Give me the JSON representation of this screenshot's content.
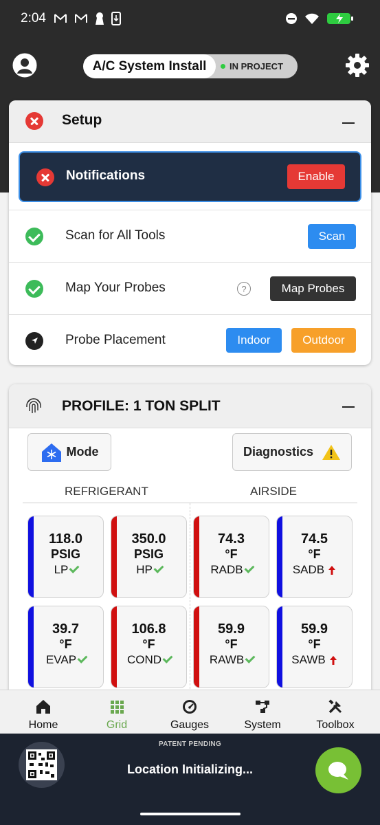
{
  "status_bar": {
    "time": "2:04"
  },
  "header": {
    "title": "A/C System Install",
    "project_status": "IN PROJECT"
  },
  "setup": {
    "title": "Setup",
    "notifications": {
      "label": "Notifications",
      "button": "Enable"
    },
    "scan": {
      "label": "Scan for All Tools",
      "button": "Scan"
    },
    "map": {
      "label": "Map Your Probes",
      "help": "?",
      "button": "Map Probes"
    },
    "placement": {
      "label": "Probe Placement",
      "indoor": "Indoor",
      "outdoor": "Outdoor"
    }
  },
  "profile": {
    "title": "PROFILE: 1 TON SPLIT",
    "mode_button": "Mode",
    "diagnostics_button": "Diagnostics",
    "refrigerant_header": "REFRIGERANT",
    "airside_header": "AIRSIDE",
    "tiles": [
      {
        "value": "118.0",
        "unit": "PSIG",
        "name": "LP",
        "status": "ok",
        "bar_color": "#1010e0"
      },
      {
        "value": "350.0",
        "unit": "PSIG",
        "name": "HP",
        "status": "ok",
        "bar_color": "#d01010"
      },
      {
        "value": "74.3",
        "unit": "°F",
        "name": "RADB",
        "status": "ok",
        "bar_color": "#d01010"
      },
      {
        "value": "74.5",
        "unit": "°F",
        "name": "SADB",
        "status": "up",
        "bar_color": "#1010e0"
      },
      {
        "value": "39.7",
        "unit": "°F",
        "name": "EVAP",
        "status": "ok",
        "bar_color": "#1010e0"
      },
      {
        "value": "106.8",
        "unit": "°F",
        "name": "COND",
        "status": "ok",
        "bar_color": "#d01010"
      },
      {
        "value": "59.9",
        "unit": "°F",
        "name": "RAWB",
        "status": "ok",
        "bar_color": "#d01010"
      },
      {
        "value": "59.9",
        "unit": "°F",
        "name": "SAWB",
        "status": "up",
        "bar_color": "#1010e0"
      }
    ]
  },
  "nav": {
    "items": [
      {
        "label": "Home"
      },
      {
        "label": "Grid"
      },
      {
        "label": "Gauges"
      },
      {
        "label": "System"
      },
      {
        "label": "Toolbox"
      }
    ]
  },
  "footer": {
    "patent": "PATENT PENDING",
    "location": "Location Initializing..."
  },
  "colors": {
    "accent_green": "#6aa84f",
    "danger_red": "#e53935",
    "primary_blue": "#2d8cf0",
    "warning_orange": "#f7a02a"
  }
}
